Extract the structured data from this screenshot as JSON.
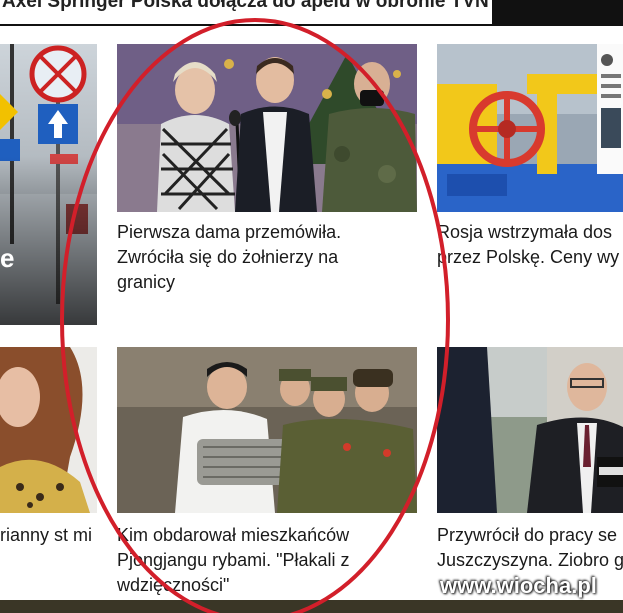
{
  "header": {
    "banner_text": "Axel Springer Polska dołącza do apelu w obronie TVN"
  },
  "articles": [
    {
      "title": "",
      "overlay_letter": "e"
    },
    {
      "title": "Pierwsza dama przemówiła. Zwróciła się do żołnierzy na granicy"
    },
    {
      "title": "Rosja wstrzymała dos przez Polskę. Ceny wy"
    },
    {
      "title": "rianny st mi"
    },
    {
      "title": "Kim obdarował mieszkańców Pjongjangu rybami. \"Płakali z wdzięczności\""
    },
    {
      "title": "Przywrócił do pracy se Juszczyszyna. Ziobro g"
    }
  ],
  "watermark": "www.wiocha.pl",
  "colors": {
    "circle": "#d21f2a",
    "topbar": "#111111"
  }
}
